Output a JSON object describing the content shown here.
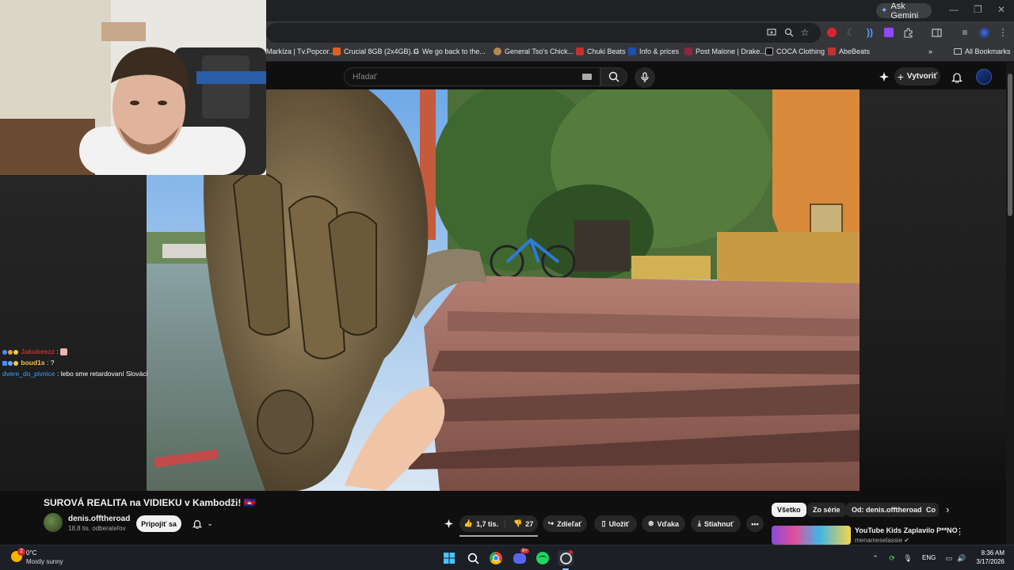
{
  "browser": {
    "ask_gemini": "Ask Gemini",
    "bookmarks": [
      {
        "label": "Markíza | Tv.Popcor...",
        "color": "#c8102e"
      },
      {
        "label": "Crucial 8GB (2x4GB)...",
        "color": "#e35f1d"
      },
      {
        "label": "We go back to the...",
        "color": "#4285f4"
      },
      {
        "label": "General Tso's Chick...",
        "color": "#b5894e"
      },
      {
        "label": "Chuki Beats",
        "color": "#c4302b"
      },
      {
        "label": "Info & prices",
        "color": "#1a4fb4"
      },
      {
        "label": "Post Malone | Drake...",
        "color": "#8e2440"
      },
      {
        "label": "COCA Clothing",
        "color": "#222222"
      },
      {
        "label": "AbeBeats",
        "color": "#c4302b"
      }
    ],
    "all_bookmarks": "All Bookmarks"
  },
  "youtube": {
    "search_placeholder": "Hľadať",
    "create_label": "Vytvoriť",
    "video_title": "SUROVÁ REALITA na VIDIEKU v Kambodži! 🇰🇭",
    "channel_name": "denis.offtheroad",
    "subscribers": "18,8 tis. odberateľov",
    "join_label": "Pripojiť sa",
    "likes": "1,7 tis.",
    "dislikes": "27",
    "share_label": "Zdieľať",
    "save_label": "Uložiť",
    "thanks_label": "Vďaka",
    "download_label": "Stiahnuť",
    "chips": [
      "Všetko",
      "Zo série",
      "Od: denis.offtheroad",
      "Co"
    ],
    "recommended": {
      "title": "YouTube Kids Zaplavilo P**NO",
      "channel": "menameselassie"
    }
  },
  "chat": [
    {
      "user": "Jakubeezz",
      "user_color": "#d12a2a",
      "message": ""
    },
    {
      "user": "boud1s",
      "user_color": "#f6c343",
      "message": "?"
    },
    {
      "user": "dvere_do_pivnice",
      "user_color": "#3aa0ff",
      "message": "lebo sme retardovaní Slováci"
    }
  ],
  "taskbar": {
    "weather_temp": "0°C",
    "weather_desc": "Mostly sunny",
    "weather_badge": "2",
    "lang": "ENG",
    "time": "8:36 AM",
    "date": "3/17/2026",
    "discord_badge": "9+"
  }
}
